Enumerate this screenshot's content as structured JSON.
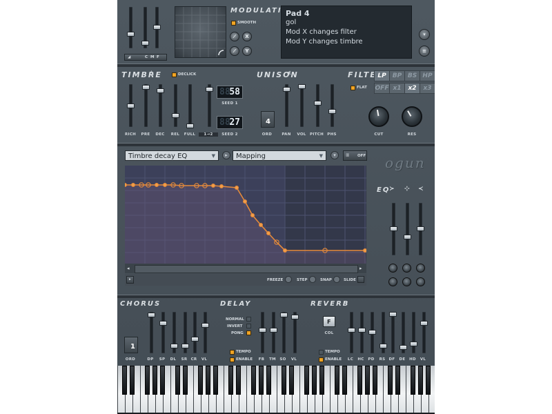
{
  "modulation": {
    "title": "MODULATION",
    "smooth_label": "SMOOTH",
    "x_label": "X",
    "y_label": "Y",
    "slider_labels": [
      "C",
      "M",
      "F"
    ]
  },
  "preset": {
    "name": "Pad 4",
    "author": "gol",
    "line1": "Mod X changes filter",
    "line2": "Mod Y changes timbre"
  },
  "timbre": {
    "title": "TIMBRE",
    "declick_label": "DECLICK",
    "slider_labels": [
      "RICH",
      "PRE",
      "DEC",
      "REL",
      "FULL"
    ],
    "link_label": "1→2",
    "seed1_value": "58",
    "seed1_label": "SEED 1",
    "seed2_value": "27",
    "seed2_label": "SEED 2"
  },
  "unison": {
    "title": "UNISON",
    "order_value": "4",
    "order_label": "ORD",
    "slider_labels": [
      "PAN",
      "VOL",
      "PITCH",
      "PHS"
    ]
  },
  "filter": {
    "title": "FILTER",
    "types": [
      "LP",
      "BP",
      "BS",
      "HP"
    ],
    "active_type": "LP",
    "flat_label": "FLAT",
    "mult_options": [
      "OFF",
      "x1",
      "x2",
      "x3"
    ],
    "active_mult": "x2",
    "cut_label": "CUT",
    "res_label": "RES"
  },
  "editor": {
    "target_select": "Timbre decay EQ",
    "mapping_select": "Mapping",
    "off_label": "OFF",
    "freeze_label": "FREEZE",
    "step_label": "STEP",
    "snap_label": "SNAP",
    "slide_label": "SLIDE"
  },
  "logo": "ogun",
  "eq": {
    "title": "EQ"
  },
  "chorus": {
    "title": "CHORUS",
    "order_value": "1",
    "order_label": "ORD",
    "slider_labels": [
      "DP",
      "SP",
      "DL",
      "SR",
      "CR",
      "VL"
    ]
  },
  "delay": {
    "title": "DELAY",
    "modes": [
      "NORMAL",
      "INVERT",
      "PONG"
    ],
    "active_mode": "PONG",
    "tempo_label": "TEMPO",
    "enable_label": "ENABLE",
    "slider_labels": [
      "FB",
      "TM",
      "SO",
      "VL"
    ]
  },
  "reverb": {
    "title": "REVERB",
    "color_value": "F",
    "color_label": "COL",
    "tempo_label": "TEMPO",
    "enable_label": "ENABLE",
    "slider_labels": [
      "LC",
      "HC",
      "PD",
      "RS",
      "DF",
      "DE",
      "HD",
      "VL"
    ]
  },
  "colors": {
    "accent": "#f1a424",
    "graph_bg": "#3a3e55",
    "curve": "#e58a3a",
    "panel": "#4b545c"
  }
}
